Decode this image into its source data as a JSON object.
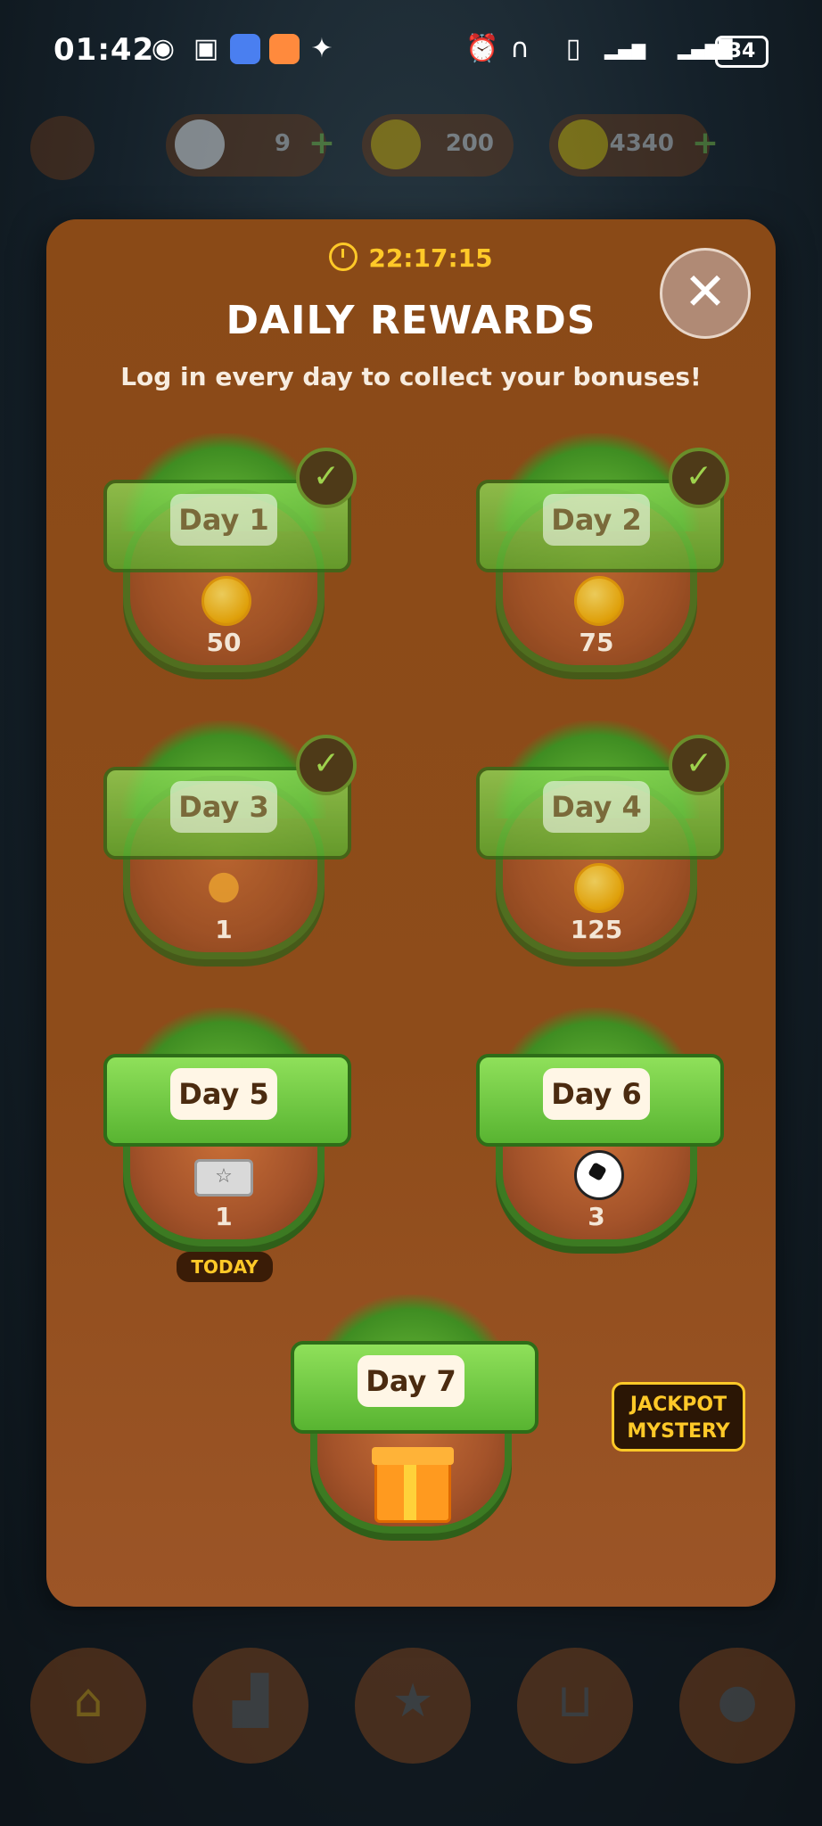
{
  "status_bar": {
    "time": "01:42",
    "battery": "34",
    "icons": [
      "eye-icon",
      "nfc-icon",
      "app-icon-blue",
      "app-icon-orange",
      "accessibility-icon",
      "alarm-icon",
      "headphones-icon",
      "vibrate-icon",
      "signal-4g-icon",
      "signal-icon"
    ]
  },
  "resources": {
    "balls": "9",
    "stars": "200",
    "coins": "4340"
  },
  "dialog": {
    "timer": "22:17:15",
    "title": "DAILY REWARDS",
    "subtitle": "Log in every day to collect your bonuses!",
    "close_icon": "close-icon",
    "days": [
      {
        "label": "Day 1",
        "reward_icon": "coin-icon",
        "amount": "50",
        "claimed": true
      },
      {
        "label": "Day 2",
        "reward_icon": "coin-icon",
        "amount": "75",
        "claimed": true
      },
      {
        "label": "Day 3",
        "reward_icon": "hint-bulb-icon",
        "amount": "1",
        "claimed": true
      },
      {
        "label": "Day 4",
        "reward_icon": "coin-icon",
        "amount": "125",
        "claimed": true
      },
      {
        "label": "Day 5",
        "reward_icon": "ticket-icon",
        "amount": "1",
        "claimed": false,
        "today": true
      },
      {
        "label": "Day 6",
        "reward_icon": "soccer-ball-icon",
        "amount": "3",
        "claimed": false
      },
      {
        "label": "Day 7",
        "reward_icon": "gift-icon",
        "claimed": false
      }
    ],
    "today_label": "TODAY",
    "jackpot_label": "JACKPOT MYSTERY"
  },
  "nav": {
    "items": [
      "home-icon",
      "leaderboard-icon",
      "trophy-icon",
      "shop-cart-icon",
      "profile-icon"
    ]
  },
  "colors": {
    "accent": "#ffc928",
    "dialog_bg": "#8e4c1a",
    "grass": "#5cb334"
  }
}
